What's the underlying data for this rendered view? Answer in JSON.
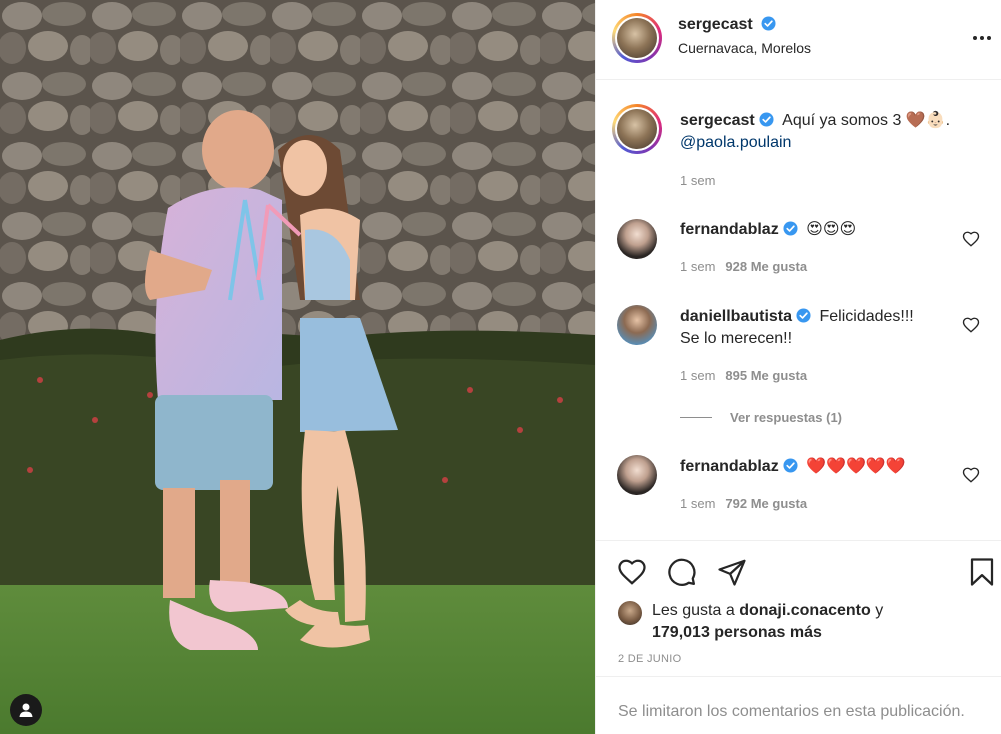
{
  "post": {
    "author": "sergecast",
    "location": "Cuernavaca, Morelos",
    "caption": {
      "username": "sergecast",
      "text": "Aquí ya somos 3 🤎👶🏻.",
      "mention": "@paola.poulain",
      "time": "1 sem"
    }
  },
  "comments": [
    {
      "username": "fernandablaz",
      "text": "😍😍😍",
      "time": "1 sem",
      "likes": "928 Me gusta"
    },
    {
      "username": "daniellbautista",
      "text": "Felicidades!!!",
      "text2": "Se lo merecen!!",
      "time": "1 sem",
      "likes": "895 Me gusta"
    },
    {
      "username": "fernandablaz",
      "text": "❤️❤️❤️❤️❤️",
      "time": "1 sem",
      "likes": "792 Me gusta"
    }
  ],
  "view_replies": "Ver respuestas (1)",
  "likes": {
    "prefix": "Les gusta a",
    "liker": "donaji.conacento",
    "connector": "y",
    "count": "179,013 personas más"
  },
  "date": "2 DE JUNIO",
  "comments_limited": "Se limitaron los comentarios en esta publicación.",
  "icons": {
    "verified": "verified-badge-icon",
    "more": "more-options-icon",
    "like": "heart-icon",
    "comment": "comment-icon",
    "share": "share-icon",
    "save": "bookmark-icon",
    "tags": "user-tag-icon"
  },
  "colors": {
    "verified": "#3897f0",
    "mention": "#00376b",
    "muted": "#8e8e8e",
    "border": "#efefef"
  }
}
